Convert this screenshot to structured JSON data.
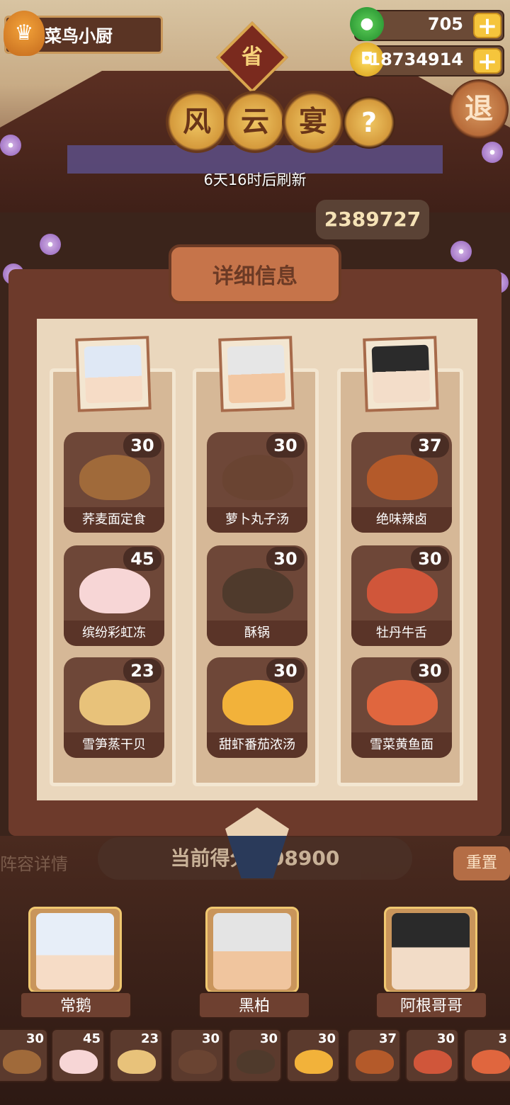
{
  "player": {
    "name": "菜鸟小厨"
  },
  "currency": {
    "jade": "705",
    "coins": "18734914"
  },
  "header": {
    "badge": "省",
    "title_chars": [
      "风",
      "云",
      "宴"
    ],
    "help": "?",
    "exit": "退",
    "refresh_text": "6天16时后刷新",
    "partial_score": "2389727"
  },
  "panel": {
    "title": "详细信息",
    "columns": [
      {
        "character": "常鹅",
        "dishes": [
          {
            "name": "荞麦面定食",
            "count": "30"
          },
          {
            "name": "缤纷彩虹冻",
            "count": "45"
          },
          {
            "name": "雪笋蒸干贝",
            "count": "23"
          }
        ]
      },
      {
        "character": "黑柏",
        "dishes": [
          {
            "name": "萝卜丸子汤",
            "count": "30"
          },
          {
            "name": "酥锅",
            "count": "30"
          },
          {
            "name": "甜虾番茄浓汤",
            "count": "30"
          }
        ]
      },
      {
        "character": "阿根哥哥",
        "dishes": [
          {
            "name": "绝味辣卤",
            "count": "37"
          },
          {
            "name": "牡丹牛舌",
            "count": "30"
          },
          {
            "name": "雪菜黄鱼面",
            "count": "30"
          }
        ]
      }
    ]
  },
  "bottom": {
    "left_hidden": "阵容详情",
    "current_score": "当前得分 208900",
    "reset": "重置",
    "characters": [
      "常鹅",
      "黑柏",
      "阿根哥哥"
    ],
    "strip_counts": [
      "30",
      "45",
      "23",
      "30",
      "30",
      "30",
      "37",
      "30",
      "3"
    ]
  },
  "colors": {
    "panel_bg": "#ead7bd",
    "dish_tile": "#6e4738",
    "accent_gold": "#f5c53c"
  }
}
